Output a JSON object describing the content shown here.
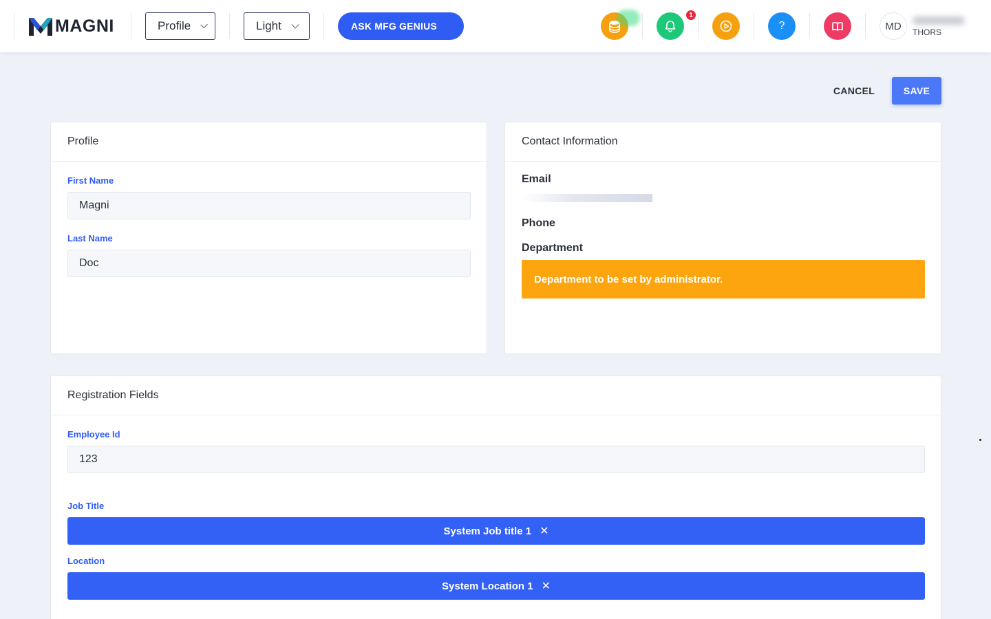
{
  "header": {
    "logo_text": "MAGNI",
    "profile_select": "Profile",
    "theme_select": "Light",
    "ask_button": "ASK MFG GENIUS",
    "notification_count": "1",
    "help_glyph": "?",
    "user": {
      "initials": "MD",
      "org": "THORS"
    },
    "icons": [
      "coins-icon",
      "bell-icon",
      "play-icon",
      "help-icon",
      "book-icon"
    ],
    "colors": {
      "coins": "#f5a00f",
      "bell": "#1ec87a",
      "play": "#f5a00f",
      "help": "#1a8ff5",
      "book": "#ee3b64"
    }
  },
  "actions": {
    "cancel": "CANCEL",
    "save": "SAVE"
  },
  "profile_card": {
    "title": "Profile",
    "first_name_label": "First Name",
    "first_name_value": "Magni",
    "last_name_label": "Last Name",
    "last_name_value": "Doc"
  },
  "contact_card": {
    "title": "Contact Information",
    "email_label": "Email",
    "phone_label": "Phone",
    "department_label": "Department",
    "department_notice": "Department to be set by administrator."
  },
  "registration_card": {
    "title": "Registration Fields",
    "employee_id_label": "Employee Id",
    "employee_id_value": "123",
    "job_title_label": "Job Title",
    "job_title_value": "System Job title 1",
    "location_label": "Location",
    "location_value": "System Location 1",
    "remove_glyph": "✕"
  }
}
